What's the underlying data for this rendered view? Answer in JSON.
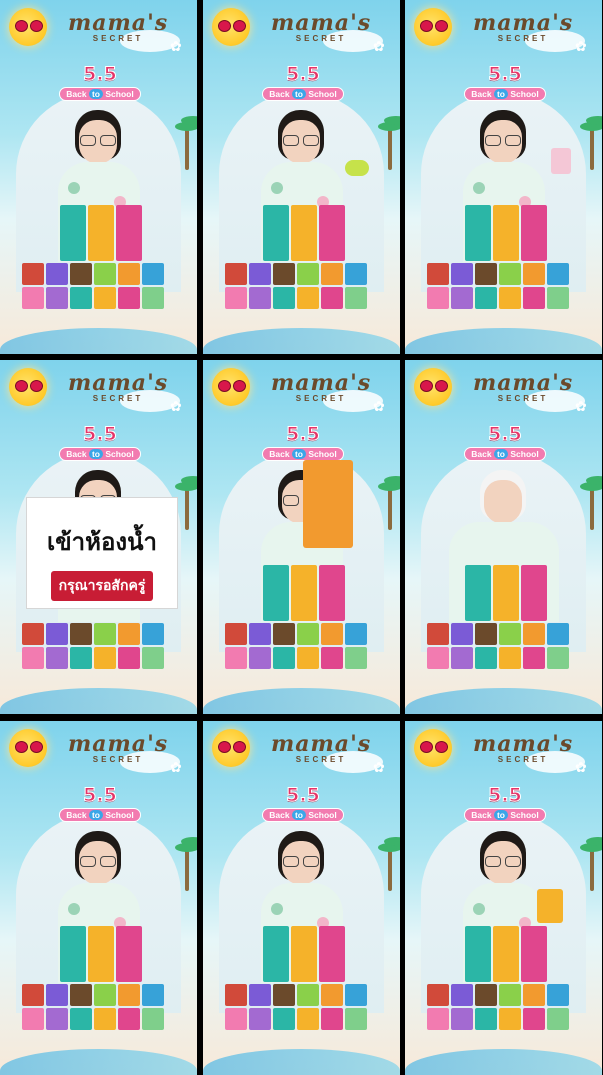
{
  "app": {
    "tiles": [
      {
        "brand": "mama's",
        "sub": "SECRET",
        "promo_num": "5.5",
        "promo_a": "Back",
        "promo_to": "to",
        "promo_b": "School"
      },
      {
        "brand": "mama's",
        "sub": "SECRET",
        "promo_num": "5.5",
        "promo_a": "Back",
        "promo_to": "to",
        "promo_b": "School"
      },
      {
        "brand": "mama's",
        "sub": "SECRET",
        "promo_num": "5.5",
        "promo_a": "Back",
        "promo_to": "to",
        "promo_b": "School"
      },
      {
        "brand": "mama's",
        "sub": "SECRET",
        "promo_num": "5.5",
        "promo_a": "Back",
        "promo_to": "to",
        "promo_b": "School"
      },
      {
        "brand": "mama's",
        "sub": "SECRET",
        "promo_num": "5.5",
        "promo_a": "Back",
        "promo_to": "to",
        "promo_b": "School"
      },
      {
        "brand": "mama's",
        "sub": "SECRET",
        "promo_num": "5.5",
        "promo_a": "Back",
        "promo_to": "to",
        "promo_b": "School"
      },
      {
        "brand": "mama's",
        "sub": "SECRET",
        "promo_num": "5.5",
        "promo_a": "Back",
        "promo_to": "to",
        "promo_b": "School"
      },
      {
        "brand": "mama's",
        "sub": "SECRET",
        "promo_num": "5.5",
        "promo_a": "Back",
        "promo_to": "to",
        "promo_b": "School"
      },
      {
        "brand": "mama's",
        "sub": "SECRET",
        "promo_num": "5.5",
        "promo_a": "Back",
        "promo_to": "to",
        "promo_b": "School"
      }
    ]
  },
  "caption": {
    "line1": "เข้าห้องน้ำ",
    "line2": "กรุณารอสักครู่"
  },
  "colors": {
    "accent_pink": "#e53468",
    "pill_pink": "#f27bb0",
    "pill_blue": "#3aa6e8",
    "caption_red": "#c81d35"
  }
}
